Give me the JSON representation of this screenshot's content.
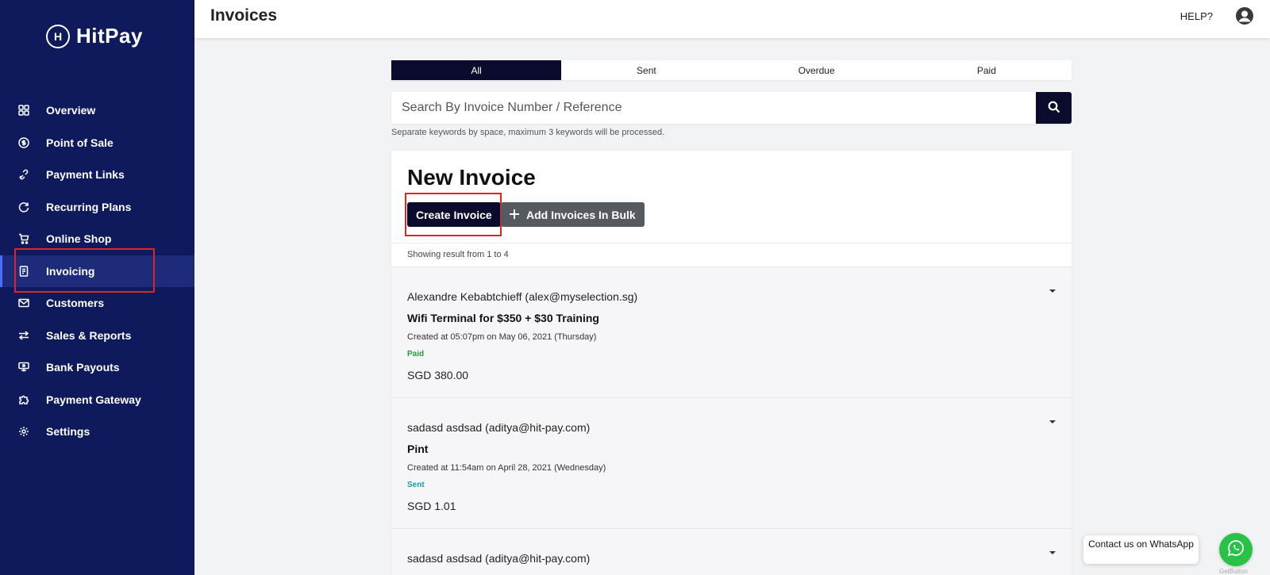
{
  "brand": {
    "name": "HitPay",
    "logo_letter": "H"
  },
  "sidebar": {
    "items": [
      {
        "label": "Overview",
        "icon": "grid-icon",
        "active": false
      },
      {
        "label": "Point of Sale",
        "icon": "dollar-circle-icon",
        "active": false
      },
      {
        "label": "Payment Links",
        "icon": "link-icon",
        "active": false
      },
      {
        "label": "Recurring Plans",
        "icon": "recurring-icon",
        "active": false
      },
      {
        "label": "Online Shop",
        "icon": "cart-icon",
        "active": false
      },
      {
        "label": "Invoicing",
        "icon": "invoice-icon",
        "active": true
      },
      {
        "label": "Customers",
        "icon": "mail-icon",
        "active": false
      },
      {
        "label": "Sales & Reports",
        "icon": "arrows-swap-icon",
        "active": false
      },
      {
        "label": "Bank Payouts",
        "icon": "bank-icon",
        "active": false
      },
      {
        "label": "Payment Gateway",
        "icon": "puzzle-icon",
        "active": false
      },
      {
        "label": "Settings",
        "icon": "gear-icon",
        "active": false
      }
    ]
  },
  "header": {
    "title": "Invoices",
    "help_label": "HELP?"
  },
  "tabs": [
    {
      "label": "All",
      "active": true
    },
    {
      "label": "Sent",
      "active": false
    },
    {
      "label": "Overdue",
      "active": false
    },
    {
      "label": "Paid",
      "active": false
    }
  ],
  "search": {
    "placeholder": "Search By Invoice Number / Reference",
    "value": "",
    "hint": "Separate keywords by space, maximum 3 keywords will be processed."
  },
  "new_invoice": {
    "title": "New Invoice",
    "create_label": "Create Invoice",
    "bulk_label": "Add Invoices In Bulk"
  },
  "results": {
    "showing": "Showing result from 1 to 4"
  },
  "invoices": [
    {
      "customer": "Alexandre Kebabtchieff (alex@myselection.sg)",
      "title": "Wifi Terminal for $350 + $30 Training",
      "created": "Created at 05:07pm on May 06, 2021 (Thursday)",
      "status": "Paid",
      "status_color": "#1e9e3c",
      "amount": "SGD 380.00"
    },
    {
      "customer": "sadasd asdsad (aditya@hit-pay.com)",
      "title": "Pint",
      "created": "Created at 11:54am on April 28, 2021 (Wednesday)",
      "status": "Sent",
      "status_color": "#1a9bb3",
      "amount": "SGD 1.01"
    },
    {
      "customer": "sadasd asdsad (aditya@hit-pay.com)",
      "title": "",
      "created": "",
      "status": "",
      "status_color": "#1a9bb3",
      "amount": ""
    }
  ],
  "whatsapp": {
    "bubble_text": "Contact us on WhatsApp",
    "credit": "GetButton"
  },
  "colors": {
    "sidebar_bg": "#0f1a5c",
    "primary_dark": "#0b0b2e",
    "highlight": "#e32222"
  }
}
